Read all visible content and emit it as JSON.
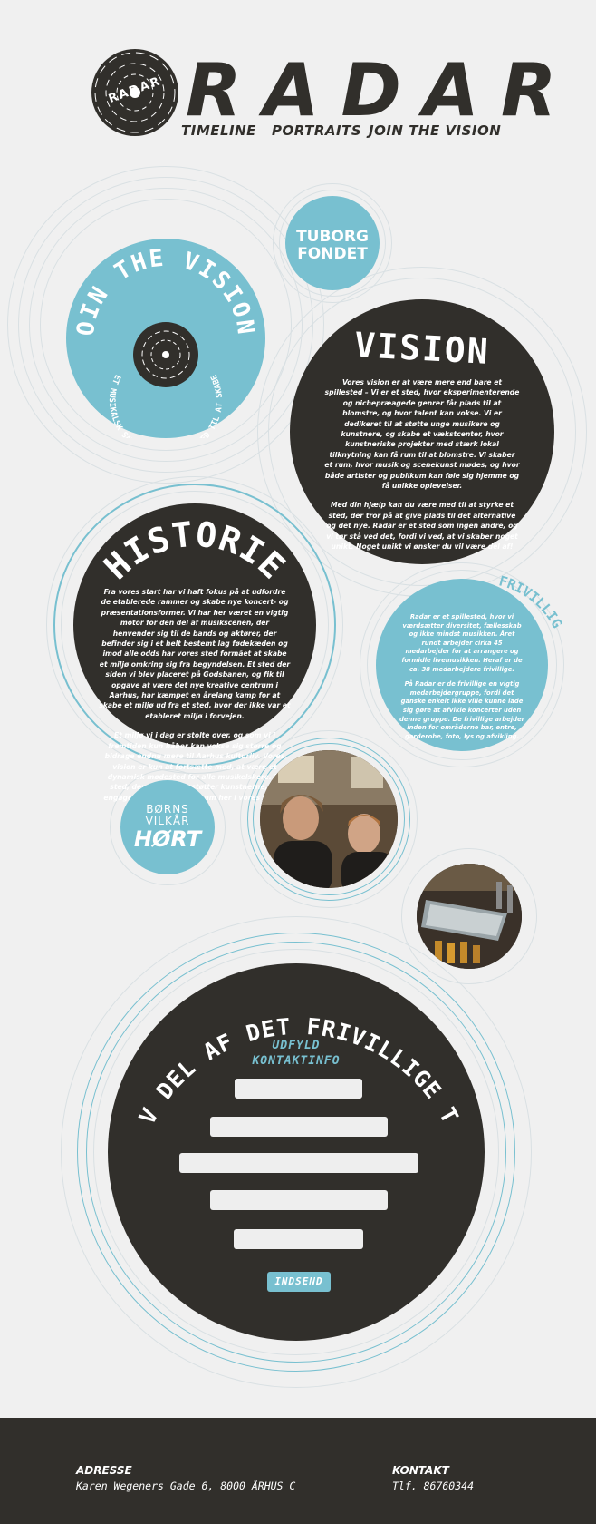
{
  "brand": {
    "name": "RADAR",
    "logo_text": "RADAR"
  },
  "nav": {
    "items": [
      {
        "label": "TIMELINE"
      },
      {
        "label": "PORTRAITS"
      },
      {
        "label": "JOIN THE VISION"
      }
    ]
  },
  "sponsors": {
    "tuborg": {
      "line1": "TUBORG",
      "line2": "FONDET"
    },
    "born": {
      "line1": "BØRNS",
      "line2": "VILKÅR",
      "line3": "HØRT"
    }
  },
  "join": {
    "title": "JOIN THE VISION!",
    "subtitle": "ET MUSIKALSK SAMLINGSPUNKT VÆR MED TIL AT SKABE"
  },
  "vision": {
    "title": "VISION",
    "paragraph1": "Vores vision er at være mere end bare et spillested – Vi er et sted, hvor eksperimenterende og nichepræagede genrer får plads til at blomstre, og hvor talent kan vokse. Vi er dedikeret til at støtte unge musikere og kunstnere, og skabe et vækstcenter, hvor kunstneriske projekter med stærk lokal tilknytning kan få rum til at blomstre. Vi skaber et rum, hvor musik og scenekunst mødes, og hvor både artister og publikum kan føle sig hjemme og få unikke oplevelser.",
    "paragraph2": "Med din hjælp kan du være med til at styrke et sted, der tror på at give plads til det alternative og det nye. Radar er et sted som ingen andre, og vi tør stå ved det, fordi vi ved, at vi skaber noget unikt. Noget unikt vi ønsker du vil være del af!"
  },
  "historie": {
    "title": "HISTORIE",
    "paragraph1": "Fra vores start har vi haft fokus på at udfordre de etablerede rammer og skabe nye koncert- og præsentationsformer. Vi har her været en vigtig motor for den del af musikscenen, der henvender sig til de bands og aktører, der befinder sig i et helt bestemt lag fødekæden og imod alle odds har vores sted formået at skabe et miljø omkring sig fra begyndelsen. Et sted der siden vi blev placeret på Godsbanen, og fik til opgave at være det nye kreative centrum i Aarhus, har kæmpet en årelang kamp for at skabe et miljø ud fra et sted, hvor der ikke var et etableret miljø i forvejen.",
    "paragraph2": "Et miljø vi i dag er stolte over, og som vi i fremtiden kun håber kan vokse sig større og bidrage endnu mere til Aarhus kulturliv. Vores vision er kun at fortsætte med, at være et dynamisk mødested for alle musikelskere. Et sted, der både understøtter kunstnerne, og engagerer et bredt publikum her i vores elsket hjemby."
  },
  "frivillig": {
    "title": "FRIVILLIG",
    "paragraph1": "Radar er et spillested, hvor vi værdsætter diversitet, fællesskab og ikke mindst musikken. Året rundt arbejder cirka 45 medarbejder for at arrangere og formidle livemusikken. Heraf er de ca. 38 medarbejdere frivillige.",
    "paragraph2": "På Radar er de frivillige en vigtig medarbejdergruppe, fordi det ganske enkelt ikke ville kunne lade sig gøre at afvikle koncerter uden denne gruppe. De frivillige arbejder inden for områderne bar, entre, garderobe, foto, lys og afvikling."
  },
  "signup": {
    "title": "BLIV DEL AF DET FRIVILLIGE TEAM",
    "prompt_line1": "UDFYLD",
    "prompt_line2": "KONTAKTINFO",
    "submit_label": "INDSEND"
  },
  "footer": {
    "address_label": "ADRESSE",
    "address_value": "Karen Wegeners Gade 6, 8000 ÅRHUS C",
    "contact_label": "KONTAKT",
    "contact_value": "Tlf. 86760344"
  },
  "colors": {
    "dark": "#312f2b",
    "teal": "#78c0d0",
    "background": "#f0f0f0",
    "ring_light": "#d6dde0"
  }
}
